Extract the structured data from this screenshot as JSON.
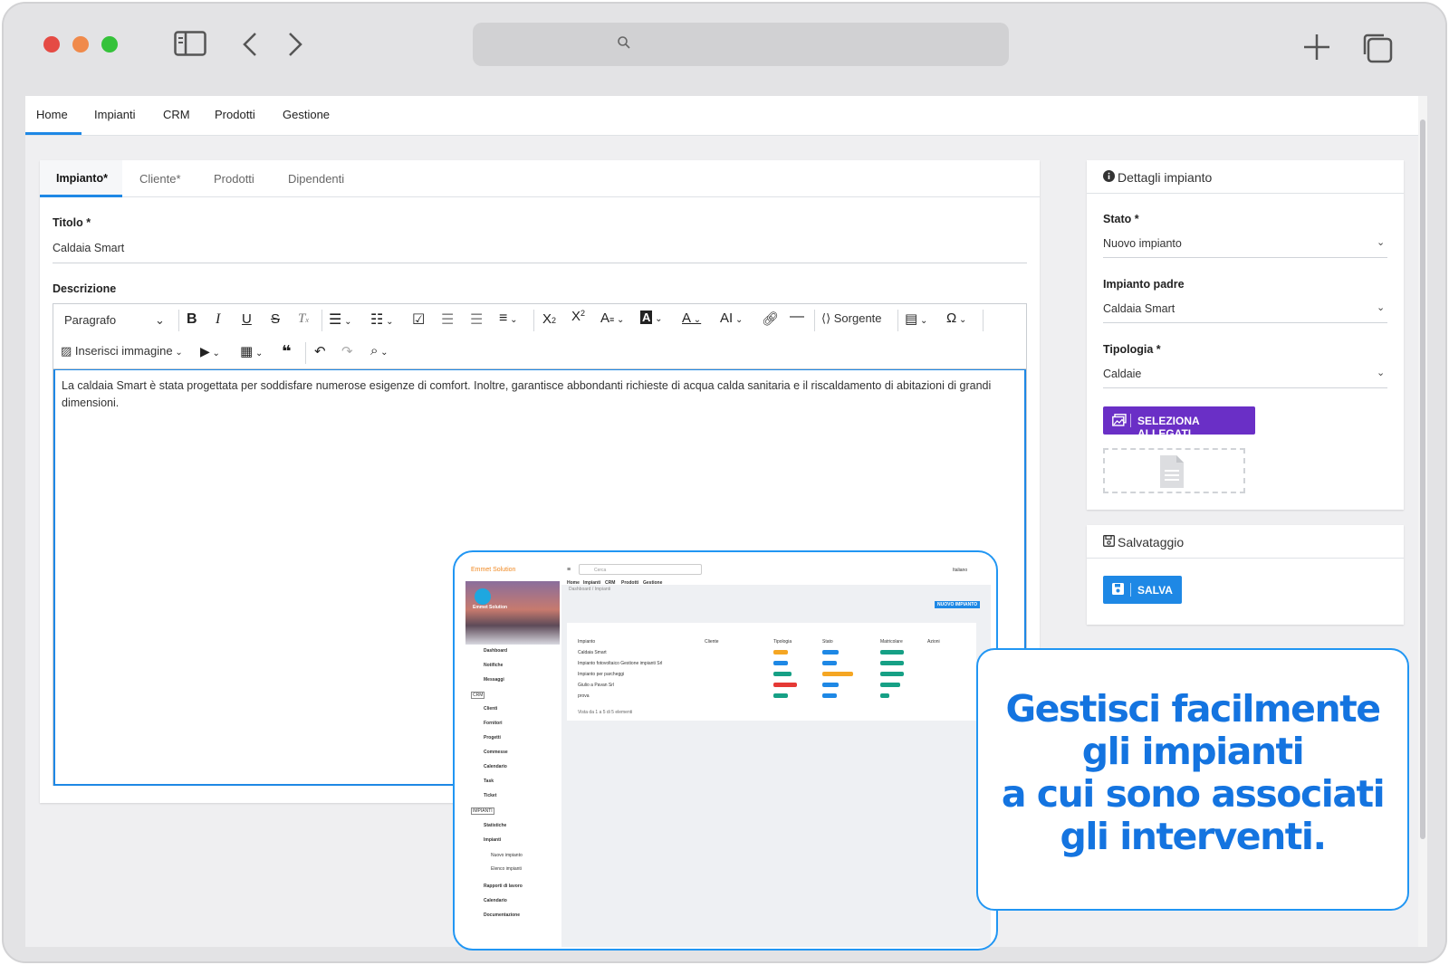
{
  "topnav": {
    "items": [
      "Home",
      "Impianti",
      "CRM",
      "Prodotti",
      "Gestione"
    ]
  },
  "tabs": [
    "Impianto*",
    "Cliente*",
    "Prodotti",
    "Dipendenti"
  ],
  "form": {
    "titolo_label": "Titolo *",
    "titolo_value": "Caldaia Smart",
    "descrizione_label": "Descrizione"
  },
  "toolbar": {
    "paragrafo": "Paragrafo",
    "sorgente": "Sorgente",
    "inserisci_immagine": "Inserisci immagine"
  },
  "editor": {
    "text": "La caldaia Smart è stata progettata per soddisfare numerose esigenze di comfort.  Inoltre, garantisce abbondanti richieste di acqua calda sanitaria e il riscaldamento di abitazioni di grandi dimensioni."
  },
  "dettagli": {
    "title": "Dettagli impianto",
    "stato_label": "Stato *",
    "stato_value": "Nuovo impianto",
    "padre_label": "Impianto padre",
    "padre_value": "Caldaia Smart",
    "tipologia_label": "Tipologia *",
    "tipologia_value": "Caldaie",
    "allegati_button": "SELEZIONA ALLEGATI"
  },
  "salvataggio": {
    "title": "Salvataggio",
    "save_button": "SALVA"
  },
  "inset": {
    "brand": "Emmet Solution",
    "search_placeholder": "Cerca",
    "language": "Italiano",
    "nav": [
      "Home",
      "Impianti",
      "CRM",
      "Prodotti",
      "Gestione"
    ],
    "breadcrumb": "Dashboard / Impianti",
    "new_button": "NUOVO IMPIANTO",
    "sidebar": [
      "Dashboard",
      "Notifiche",
      "Messaggi",
      "Clienti",
      "Fornitori",
      "Progetti",
      "Commesse",
      "Calendario",
      "Task",
      "Ticket",
      "Statistiche",
      "Impianti",
      "Nuovo impianto",
      "Elenco impianti",
      "Rapporti di lavoro",
      "Calendario",
      "Documentazione"
    ],
    "section_crm": "CRM",
    "section_impianti": "IMPIANTI",
    "table_headers": [
      "Impianto",
      "Cliente",
      "Tipologia",
      "Stato",
      "Matricolare",
      "Azioni"
    ],
    "rows": [
      "Caldaia Smart",
      "Impianto fotovoltaico Gestione impianti Srl",
      "Impianto per parcheggi",
      "Giulio a Pavan Srl",
      "prova"
    ],
    "footer": "Vista da 1 a 5 di 5 elementi"
  },
  "callout": {
    "lines": [
      "Gestisci facilmente",
      "gli impianti",
      "a cui sono associati",
      "gli interventi."
    ]
  },
  "colors": {
    "accent": "#1e88e5",
    "purple_button": "#6a2fc6",
    "callout_text": "#1474e0"
  }
}
